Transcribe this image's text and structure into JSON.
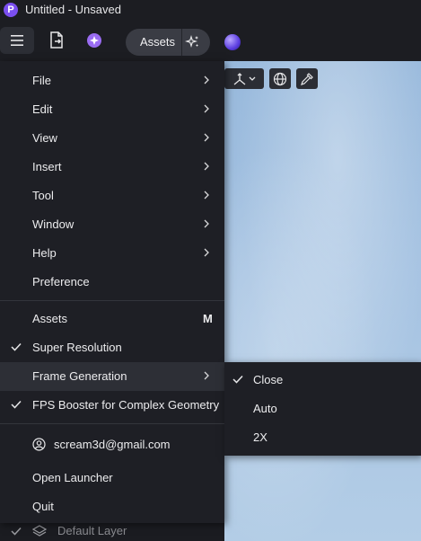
{
  "window": {
    "title": "Untitled - Unsaved",
    "logo_letter": "P"
  },
  "toolbar": {
    "assets_label": "Assets",
    "icons": [
      "hamburger-icon",
      "export-file-icon",
      "ai-sparkle-icon",
      "sparkle-icon",
      "orb-icon"
    ]
  },
  "viewport_tools": [
    "axis-icon",
    "chevron-down-icon",
    "globe-icon",
    "eyedropper-icon"
  ],
  "menu": {
    "items": [
      {
        "label": "File",
        "submenu": true
      },
      {
        "label": "Edit",
        "submenu": true
      },
      {
        "label": "View",
        "submenu": true
      },
      {
        "label": "Insert",
        "submenu": true
      },
      {
        "label": "Tool",
        "submenu": true
      },
      {
        "label": "Window",
        "submenu": true
      },
      {
        "label": "Help",
        "submenu": true
      },
      {
        "label": "Preference",
        "submenu": false
      }
    ],
    "assets": {
      "label": "Assets",
      "shortcut": "M"
    },
    "super_resolution": {
      "label": "Super Resolution",
      "checked": true
    },
    "frame_generation": {
      "label": "Frame Generation",
      "submenu": true,
      "highlighted": true
    },
    "fps_booster": {
      "label": "FPS Booster for Complex Geometry",
      "checked": true
    },
    "account": {
      "label": "scream3d@gmail.com"
    },
    "open_launcher": {
      "label": "Open Launcher"
    },
    "quit": {
      "label": "Quit"
    }
  },
  "submenu": {
    "items": [
      {
        "label": "Close",
        "checked": true
      },
      {
        "label": "Auto",
        "checked": false
      },
      {
        "label": "2X",
        "checked": false
      }
    ]
  },
  "layer_row": {
    "label": "Default Layer",
    "checked": true
  },
  "colors": {
    "menu_bg": "#1e1f25",
    "hover_bg": "#2d2f36",
    "accent": "#7b4ff0",
    "sky": "#a6c3e2"
  }
}
